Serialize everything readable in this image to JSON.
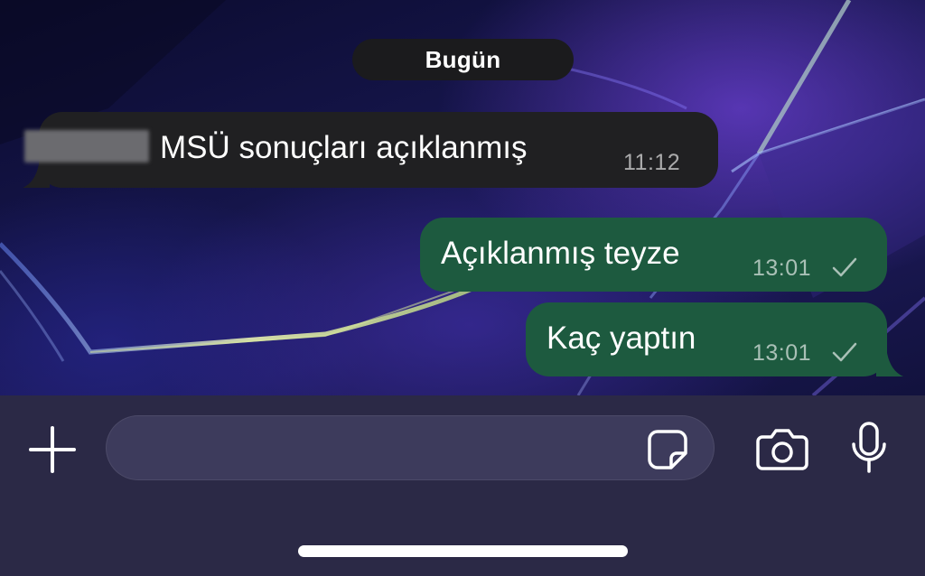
{
  "chat": {
    "date_separator": "Bugün",
    "messages": [
      {
        "direction": "incoming",
        "text": "MSÜ sonuçları açıklanmış",
        "time": "11:12",
        "sender_redacted": true
      },
      {
        "direction": "outgoing",
        "text": "Açıklanmış teyze",
        "time": "13:01",
        "status_icon": "check-icon"
      },
      {
        "direction": "outgoing",
        "text": "Kaç yaptın",
        "time": "13:01",
        "status_icon": "check-icon"
      }
    ]
  },
  "composer": {
    "placeholder": "",
    "buttons": {
      "attach": "plus-icon",
      "sticker": "sticker-icon",
      "camera": "camera-icon",
      "voice": "microphone-icon"
    }
  },
  "theme": {
    "incoming_bubble": "#202022",
    "outgoing_bubble": "#1d5a3f",
    "composer_bar": "#2b2946"
  }
}
